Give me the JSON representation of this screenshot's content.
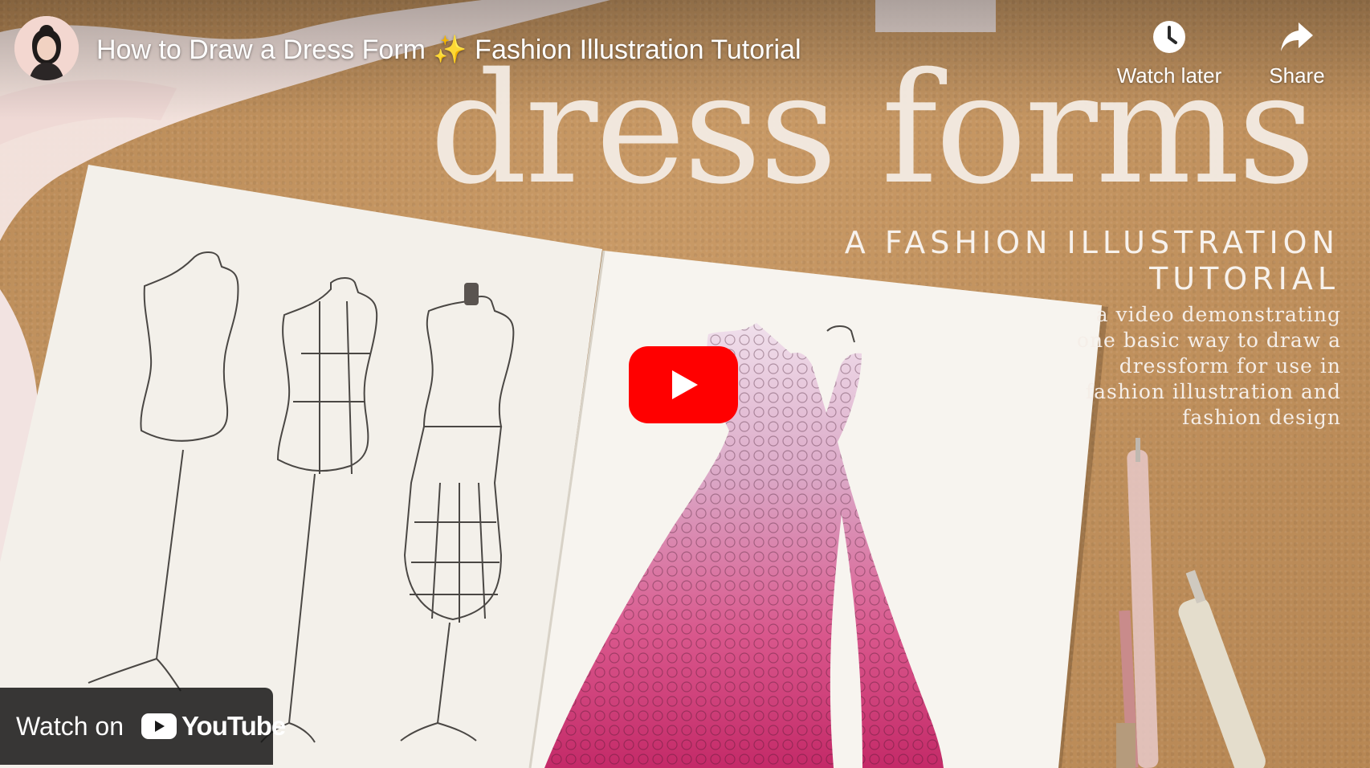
{
  "video": {
    "title": "How to Draw a Dress Form ✨ Fashion Illustration Tutorial"
  },
  "actions": {
    "watch_later_label": "Watch later",
    "share_label": "Share"
  },
  "thumbnail": {
    "big_title": "dress forms",
    "subtitle_line1": "A FASHION ILLUSTRATION",
    "subtitle_line2": "TUTORIAL",
    "blurb": "a video demonstrating one basic way to draw a dressform for use in fashion illustration and fashion design"
  },
  "footer": {
    "watch_on_label": "Watch on",
    "brand": "YouTube"
  },
  "icons": {
    "watch_later": "clock-icon",
    "share": "share-arrow-icon",
    "play": "play-icon",
    "brand": "youtube-logo-icon"
  },
  "colors": {
    "brand_red": "#ff0000",
    "overlay_text": "#ffffff",
    "cork": "#c49461"
  }
}
